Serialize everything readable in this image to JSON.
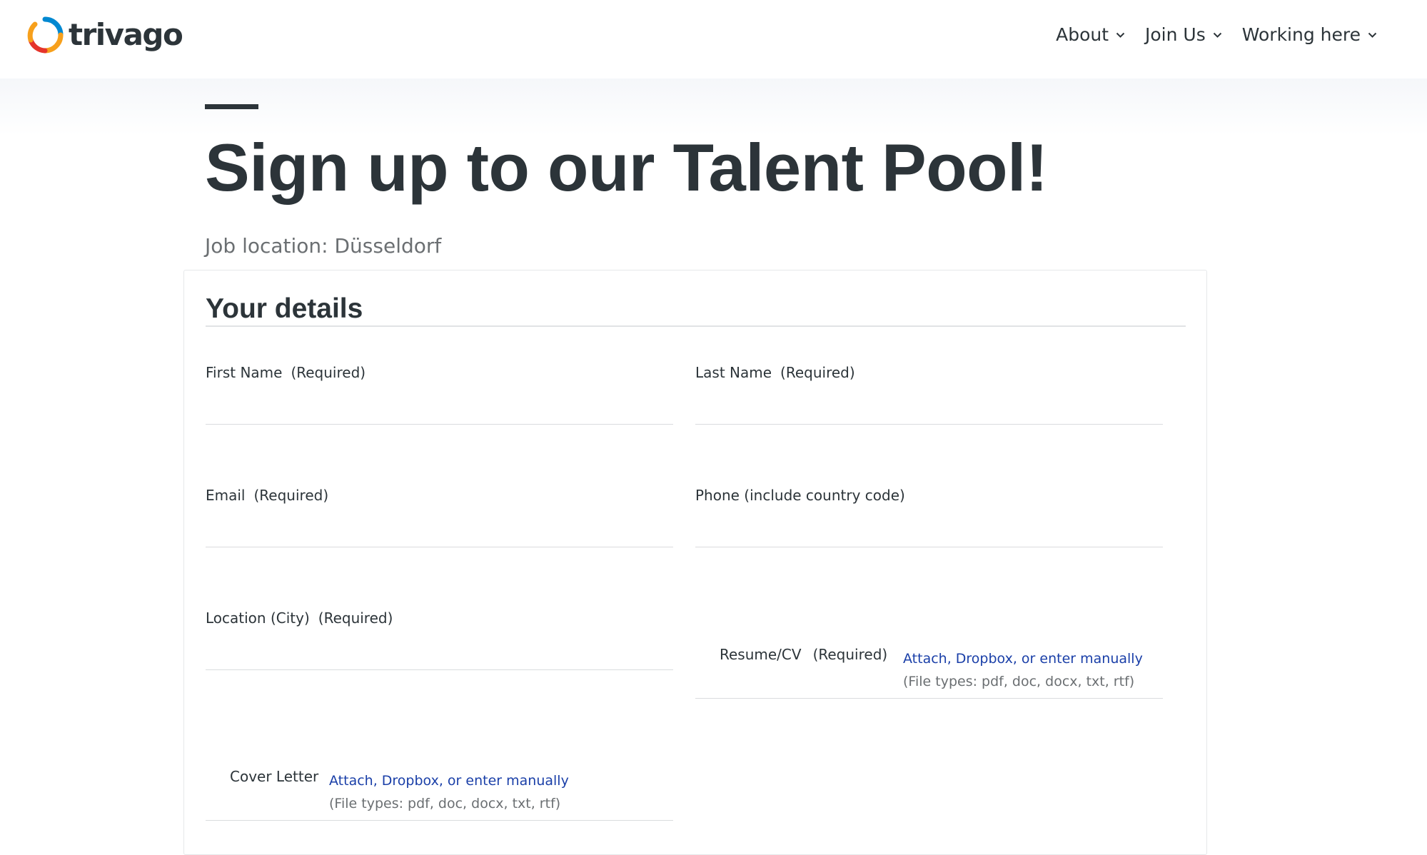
{
  "header": {
    "logo_text": "trivago",
    "nav": [
      {
        "label": "About"
      },
      {
        "label": "Join Us"
      },
      {
        "label": "Working here"
      }
    ]
  },
  "page": {
    "title": "Sign up to our Talent Pool!",
    "job_location": "Job location: Düsseldorf"
  },
  "form": {
    "section_title": "Your details",
    "first_name": {
      "label": "First Name",
      "required": "(Required)",
      "value": ""
    },
    "last_name": {
      "label": "Last Name",
      "required": "(Required)",
      "value": ""
    },
    "email": {
      "label": "Email",
      "required": "(Required)",
      "value": ""
    },
    "phone": {
      "label": "Phone (include country code)",
      "value": ""
    },
    "location_city": {
      "label": "Location (City)",
      "required": "(Required)",
      "value": ""
    },
    "resume": {
      "label": "Resume/CV",
      "required": "(Required)",
      "attach": "Attach,",
      "dropbox": "Dropbox,",
      "or": "or",
      "manual": "enter manually",
      "file_types": "(File types: pdf, doc, docx, txt, rtf)"
    },
    "cover_letter": {
      "label": "Cover Letter",
      "attach": "Attach,",
      "dropbox": "Dropbox,",
      "or": "or",
      "manual": "enter manually",
      "file_types": "(File types: pdf, doc, docx, txt, rtf)"
    }
  },
  "colors": {
    "text": "#2c3439",
    "muted": "#6b6f72",
    "link": "#1a3fa8",
    "logo_ring": [
      "#f7a01c",
      "#e5342b",
      "#0088d1"
    ]
  }
}
